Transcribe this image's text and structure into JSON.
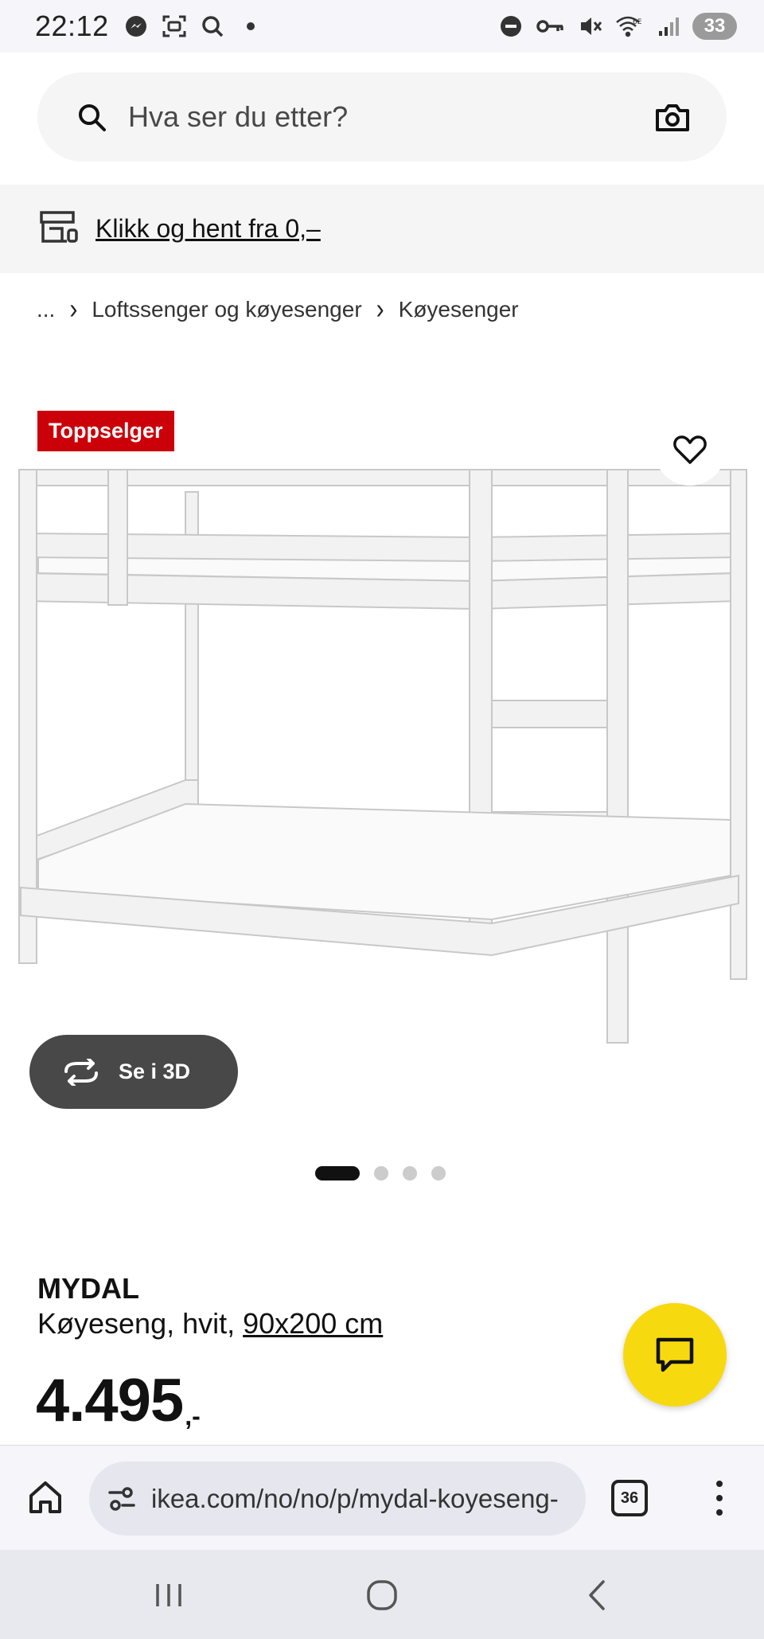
{
  "status": {
    "time": "22:12",
    "battery": "33",
    "icons_left": [
      "messenger-icon",
      "screenshot-icon",
      "search-icon",
      "dot-icon"
    ],
    "icons_right": [
      "dnd-icon",
      "key-icon",
      "mute-icon",
      "wifi-icon",
      "signal-icon"
    ]
  },
  "search": {
    "placeholder": "Hva ser du etter?"
  },
  "click_collect": {
    "label": "Klikk og hent fra 0,–"
  },
  "breadcrumb": {
    "more": "...",
    "items": [
      "Loftssenger og køyesenger",
      "Køyesenger"
    ]
  },
  "gallery": {
    "badge": "Toppselger",
    "view3d_label": "Se i 3D",
    "slides_total": 4,
    "active_slide": 1
  },
  "product": {
    "name": "MYDAL",
    "desc_prefix": "Køyeseng, hvit, ",
    "dimension": "90x200 cm",
    "price_int": "4.495",
    "price_suffix": ",-"
  },
  "browser": {
    "url": "ikea.com/no/no/p/mydal-koyeseng-",
    "tab_count": "36"
  },
  "colors": {
    "badge": "#cc0008",
    "chat": "#f7d90f",
    "button_dark": "#484848"
  }
}
